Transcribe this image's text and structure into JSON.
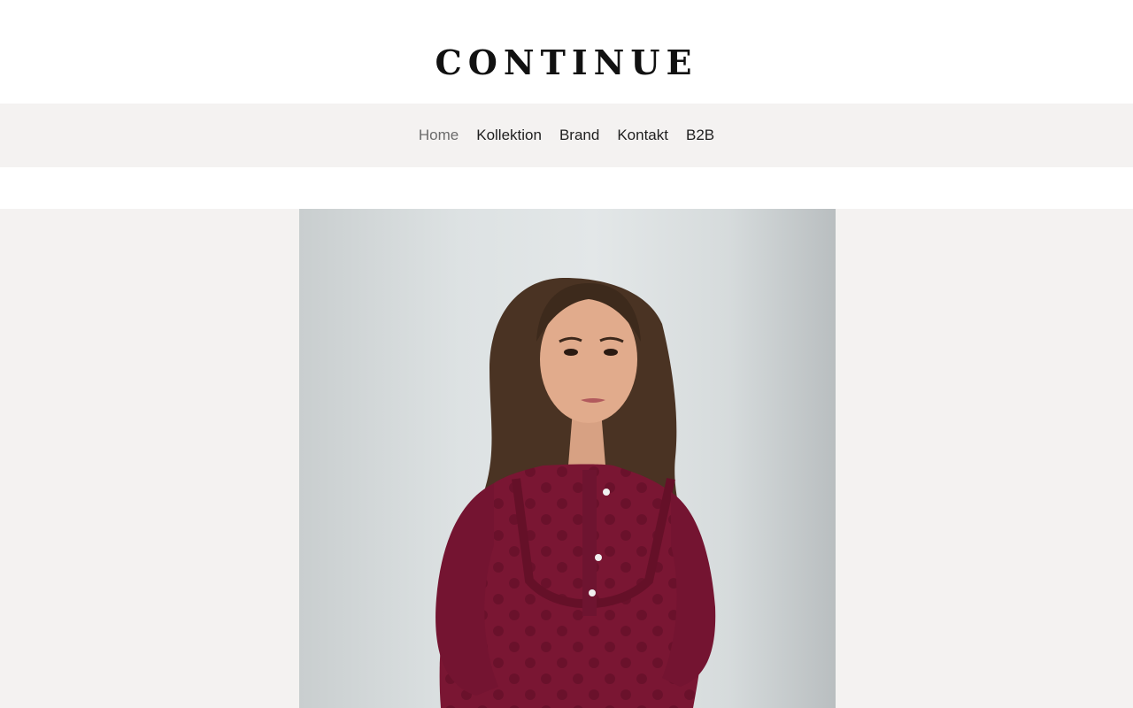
{
  "brand": {
    "logo_text": "CONTINUE"
  },
  "nav": {
    "items": [
      {
        "label": "Home",
        "active": true
      },
      {
        "label": "Kollektion",
        "active": false
      },
      {
        "label": "Brand",
        "active": false
      },
      {
        "label": "Kontakt",
        "active": false
      },
      {
        "label": "B2B",
        "active": false
      }
    ]
  },
  "hero": {
    "image_subject": "model-in-burgundy-polka-dot-blouse"
  },
  "colors": {
    "nav_background": "#f4f2f1",
    "hero_background": "#f4f2f1",
    "nav_text": "#1f1f1f",
    "nav_active_text": "#6b6b6b",
    "logo_text": "#111111",
    "blouse": "#7a1633"
  }
}
